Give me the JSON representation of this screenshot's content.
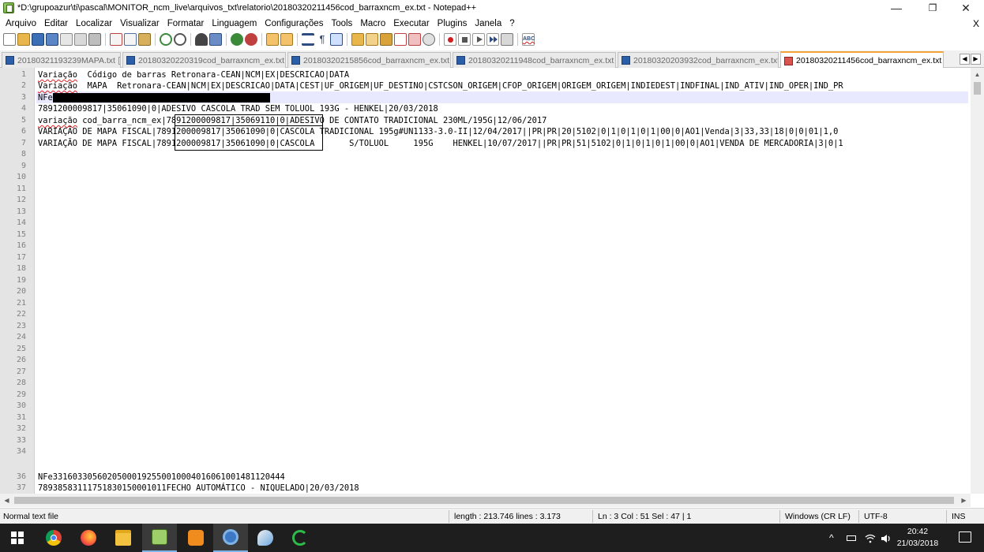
{
  "window": {
    "title": "*D:\\grupoazur\\ti\\pascal\\MONITOR_ncm_live\\arquivos_txt\\relatorio\\20180320211456cod_barraxncm_ex.txt - Notepad++",
    "minimize": "—",
    "maximize": "❐",
    "close": "✕"
  },
  "menu": {
    "items": [
      "Arquivo",
      "Editar",
      "Localizar",
      "Visualizar",
      "Formatar",
      "Linguagem",
      "Configurações",
      "Tools",
      "Macro",
      "Executar",
      "Plugins",
      "Janela",
      "?"
    ],
    "close": "X"
  },
  "toolbar": {
    "icons": [
      "new-file-icon",
      "open-file-icon",
      "save-icon",
      "save-all-icon",
      "close-icon",
      "close-all-icon",
      "print-icon",
      "cut-icon",
      "copy-icon",
      "paste-icon",
      "undo-icon",
      "redo-icon",
      "find-icon",
      "replace-icon",
      "zoom-in-icon",
      "zoom-out-icon",
      "sync-vertical-icon",
      "sync-horizontal-icon",
      "word-wrap-icon",
      "show-all-chars-icon",
      "indent-guide-icon",
      "user-lang-icon",
      "doc-map-icon",
      "function-list-icon",
      "folder-workspace-icon",
      "monitor-icon",
      "record-macro-icon",
      "stop-macro-icon",
      "play-macro-icon",
      "run-macro-multiple-icon",
      "save-macro-icon",
      "spellcheck-icon"
    ]
  },
  "tabs": [
    {
      "label": "20180321193239MAPA.txt",
      "active": false
    },
    {
      "label": "20180320220319cod_barraxncm_ex.txt",
      "active": false
    },
    {
      "label": "20180320215856cod_barraxncm_ex.txt",
      "active": false
    },
    {
      "label": "20180320211948cod_barraxncm_ex.txt",
      "active": false
    },
    {
      "label": "20180320203932cod_barraxncm_ex.txt",
      "active": false
    },
    {
      "label": "20180320211456cod_barraxncm_ex.txt",
      "active": true
    }
  ],
  "tab_arrows": [
    "◀",
    "▶"
  ],
  "editor": {
    "line_numbers": [
      "1",
      "2",
      "3",
      "4",
      "5",
      "6",
      "7",
      "8",
      "9",
      "10",
      "11",
      "12",
      "13",
      "14",
      "15",
      "16",
      "17",
      "18",
      "19",
      "20",
      "21",
      "22",
      "23",
      "24",
      "25",
      "26",
      "27",
      "28",
      "29",
      "30",
      "31",
      "32",
      "33",
      "34",
      "36",
      "37"
    ],
    "lines": {
      "l1_a": "Variação",
      "l1_b": "  Código de barras Retronara-CEAN|NCM|EX|DESCRICAO|DATA",
      "l2_a": "Variação",
      "l2_b": "  MAPA  Retronara-CEAN|NCM|EX|DESCRICAO|DATA|CEST|UF_ORIGEM|UF_DESTINO|CSTCSON_ORIGEM|CFOP_ORIGEM|ORIGEM_ORIGEM|INDIEDEST|INDFINAL|IND_ATIV|IND_OPER|IND_PR",
      "l3_a": "NFe",
      "l3_redacted": "3-------------------------------------------",
      "l4": "7891200009817|35061090|0|ADESIVO CASCOLA TRAD SEM TOLUOL 193G - HENKEL|20/03/2018",
      "l5_a": "variação",
      "l5_b": " cod_barra_ncm_ex|7891200009817|35069110|0|ADESIVO DE CONTATO TRADICIONAL 230ML/195G|12/06/2017",
      "l6": "VARIAÇÃO DE MAPA FISCAL|7891200009817|35061090|0|CASCOLA TRADICIONAL 195g#UN1133-3.0-II|12/04/2017||PR|PR|20|5102|0|1|0|1|0|1|00|0|AO1|Venda|3|33,33|18|0|0|01|1,0",
      "l7": "VARIAÇÃO DE MAPA FISCAL|7891200009817|35061090|0|CASCOLA       S/TOLUOL     195G    HENKEL|10/07/2017||PR|PR|51|5102|0|1|0|1|0|1|00|0|AO1|VENDA DE MERCADORIA|3|0|1",
      "l36": "NFe33160330560205000192550010004016061001481120444",
      "l37": "78938583111751830150001011FECHO AUTOMÁTICO - NIQUELADO|20/03/2018"
    }
  },
  "status": {
    "filetype": "Normal text file",
    "length": "length : 213.746    lines : 3.173",
    "position": "Ln : 3    Col : 51    Sel : 47 | 1",
    "eol": "Windows (CR LF)",
    "encoding": "UTF-8",
    "mode": "INS"
  },
  "taskbar": {
    "apps": [
      "windows-start-icon",
      "chrome-icon",
      "firefox-icon",
      "file-explorer-icon",
      "notepadplusplus-icon",
      "sublime-icon",
      "settings-app-icon",
      "paint-icon",
      "sync-app-icon"
    ],
    "time": "20:42",
    "date": "21/03/2018",
    "tray_chevron": "^"
  }
}
